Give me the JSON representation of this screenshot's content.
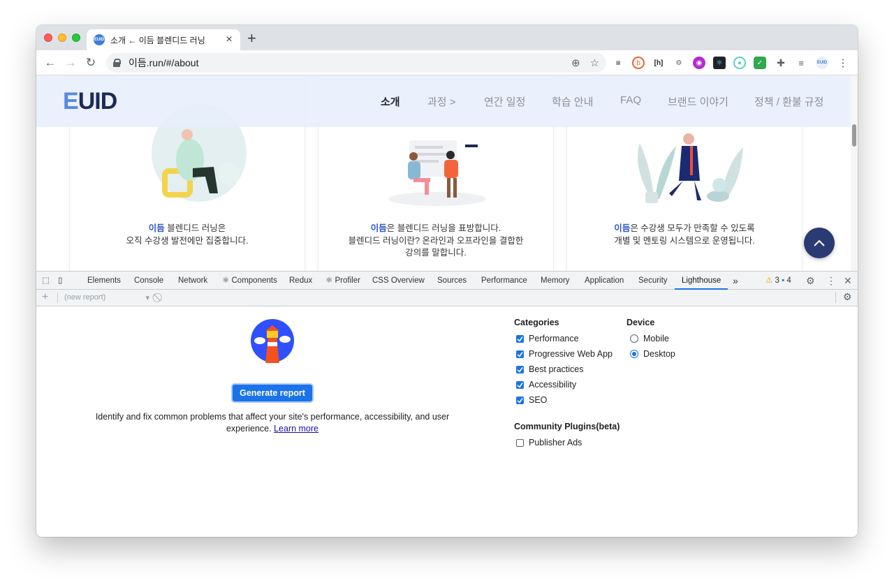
{
  "browser": {
    "tab_title": "소개 ← 이듬 블렌디드 러닝",
    "tab_favicon_text": "EUID",
    "url": "이듬.run/#/about"
  },
  "site": {
    "logo_e": "E",
    "logo_rest": "UID",
    "nav": [
      "소개",
      "과정 >",
      "연간 일정",
      "학습 안내",
      "FAQ",
      "브랜드 이야기",
      "정책 / 환불 규정"
    ],
    "cards": [
      {
        "highlight": "이듬",
        "line1": " 블렌디드 러닝은",
        "line2": "오직 수강생 발전에만 집중합니다.",
        "line3": ""
      },
      {
        "highlight": "이듬",
        "line1": "은 블렌디드 러닝을 표방합니다.",
        "line2": "블렌디드 러닝이란? 온라인과 오프라인을 결합한",
        "line3": "강의를 말합니다."
      },
      {
        "highlight": "이듬",
        "line1": "은 수강생 모두가 만족할 수 있도록",
        "line2": "개별 및 멘토링 시스템으로 운영됩니다.",
        "line3": ""
      }
    ]
  },
  "devtools": {
    "tabs": [
      "Elements",
      "Console",
      "Network",
      "⚛ Components",
      "Redux",
      "⚛ Profiler",
      "CSS Overview",
      "Sources",
      "Performance",
      "Memory",
      "Application",
      "Security",
      "Lighthouse"
    ],
    "more": "»",
    "warnings": "3",
    "messages": "4",
    "report_select": "(new report)",
    "generate_label": "Generate report",
    "description": "Identify and fix common problems that affect your site's performance, accessibility, and user experience.",
    "learn_more": "Learn more",
    "categories_title": "Categories",
    "categories": [
      {
        "label": "Performance",
        "checked": true
      },
      {
        "label": "Progressive Web App",
        "checked": true
      },
      {
        "label": "Best practices",
        "checked": true
      },
      {
        "label": "Accessibility",
        "checked": true
      },
      {
        "label": "SEO",
        "checked": true
      }
    ],
    "device_title": "Device",
    "devices": [
      {
        "label": "Mobile",
        "selected": false
      },
      {
        "label": "Desktop",
        "selected": true
      }
    ],
    "plugins_title": "Community Plugins(beta)",
    "plugins": [
      {
        "label": "Publisher Ads",
        "checked": false
      }
    ]
  },
  "colors": {
    "accent": "#1a73e8",
    "brand_navy": "#1c2a56",
    "brand_blue": "#5688e8",
    "highlight": "#2e57c9"
  }
}
